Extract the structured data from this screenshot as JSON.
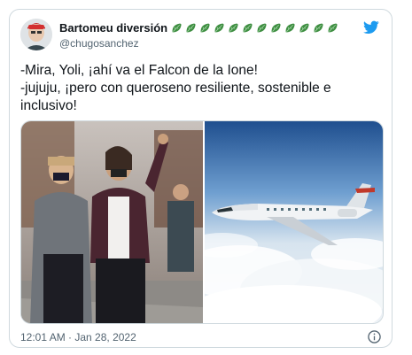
{
  "tweet": {
    "display_name": "Bartomeu diversión",
    "handle": "@chugosanchez",
    "name_emoji_icon": "green-leaf-emoji-icon",
    "name_emoji_count": 12,
    "lines": [
      "-Mira, Yoli, ¡ahí va el Falcon de la Ione!",
      "-jujuju, ¡pero con queroseno resiliente, sostenible e",
      "inclusivo!"
    ],
    "timestamp": "12:01 AM · Jan 28, 2022",
    "brand_color": "#1d9bf0"
  }
}
